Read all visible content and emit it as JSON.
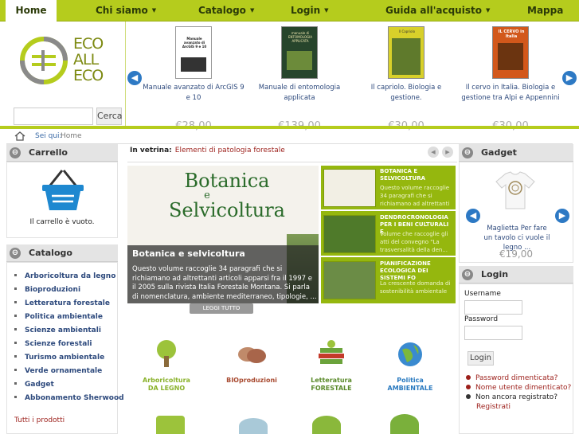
{
  "nav": {
    "items": [
      {
        "label": "Home"
      },
      {
        "label": "Chi siamo"
      },
      {
        "label": "Catalogo"
      },
      {
        "label": "Login"
      },
      {
        "label": "Guida all'acquisto"
      },
      {
        "label": "Mappa"
      }
    ]
  },
  "logo": {
    "line1": "ECO",
    "line2": "ALL",
    "line3": "ECO"
  },
  "search": {
    "button": "Cerca",
    "value": ""
  },
  "carousel": {
    "products": [
      {
        "name": "Manuale avanzato di ArcGIS 9 e 10",
        "price": "€28,00",
        "cover_title": "Manuale avanzato di ArcGIS 9 e 10"
      },
      {
        "name": "Manuale di entomologia applicata",
        "price": "€139,00",
        "cover_title": "manuale di ENTOMOLOGIA APPLICATA"
      },
      {
        "name": "Il capriolo. Biologia e gestione.",
        "price": "€30,00",
        "cover_title": "Il Capriolo"
      },
      {
        "name": "Il cervo in Italia. Biologia e gestione tra Alpi e Appennini",
        "price": "€30,00",
        "cover_title": "IL CERVO in Italia"
      }
    ]
  },
  "breadcrumb": {
    "you_are_here": "Sei qui:",
    "current": "Home"
  },
  "cart": {
    "title": "Carrello",
    "empty_text": "Il carrello è vuoto."
  },
  "catalog": {
    "title": "Catalogo",
    "items": [
      "Arboricoltura da legno",
      "Bioproduzioni",
      "Letteratura forestale",
      "Politica ambientale",
      "Scienze ambientali",
      "Scienze forestali",
      "Turismo ambientale",
      "Verde ornamentale",
      "Gadget",
      "Abbonamento Sherwood"
    ],
    "all_products": "Tutti i prodotti"
  },
  "showcase": {
    "label": "In vetrina:",
    "current": "Elementi di patologia forestale",
    "feature_title": "Botanica e selvicoltura",
    "feature_cover_line1": "Botanica",
    "feature_cover_line2": "e",
    "feature_cover_line3": "Selvicoltura",
    "feature_text": "Questo volume raccoglie 34 paragrafi che si richiamano ad altrettanti articoli apparsi fra il 1997 e il 2005 sulla rivista Italia Forestale Montana. Si parla di nomenclatura, ambiente mediterraneo, tipologie, ...",
    "read_all": "LEGGI TUTTO",
    "side_items": [
      {
        "title": "BOTANICA E SELVICOLTURA",
        "desc": "Questo volume raccoglie 34 paragrafi che si richiamano ad altrettanti ..."
      },
      {
        "title": "DENDROCRONOLOGIA PER I BENI CULTURALI E",
        "desc": "Volume che raccoglie gli atti del convegno \"La trasversalità della den..."
      },
      {
        "title": "PIANIFICAZIONE ECOLOGICA DEI SISTEMI FO",
        "desc": "La crescente domanda di sostenibilità ambientale"
      }
    ]
  },
  "category_icons": [
    {
      "line1": "Arboricoltura",
      "line2": "DA LEGNO"
    },
    {
      "line1": "BIOproduzioni",
      "line2": ""
    },
    {
      "line1": "Letteratura",
      "line2": "FORESTALE"
    },
    {
      "line1": "Politica",
      "line2": "AMBIENTALE"
    }
  ],
  "gadget": {
    "title": "Gadget",
    "name": "Maglietta Per fare un tavolo ci vuole il legno ...",
    "price": "€19,00"
  },
  "login": {
    "title": "Login",
    "username_label": "Username",
    "password_label": "Password",
    "button": "Login",
    "forgot_password": "Password dimenticata?",
    "forgot_username": "Nome utente dimenticato?",
    "not_registered": "Non ancora registrato?",
    "register": "Registrati"
  },
  "colors": {
    "accent": "#b5cc1d",
    "link": "#2e4a7d",
    "red_link": "#9c1f1a",
    "arrow": "#2d79c4"
  }
}
